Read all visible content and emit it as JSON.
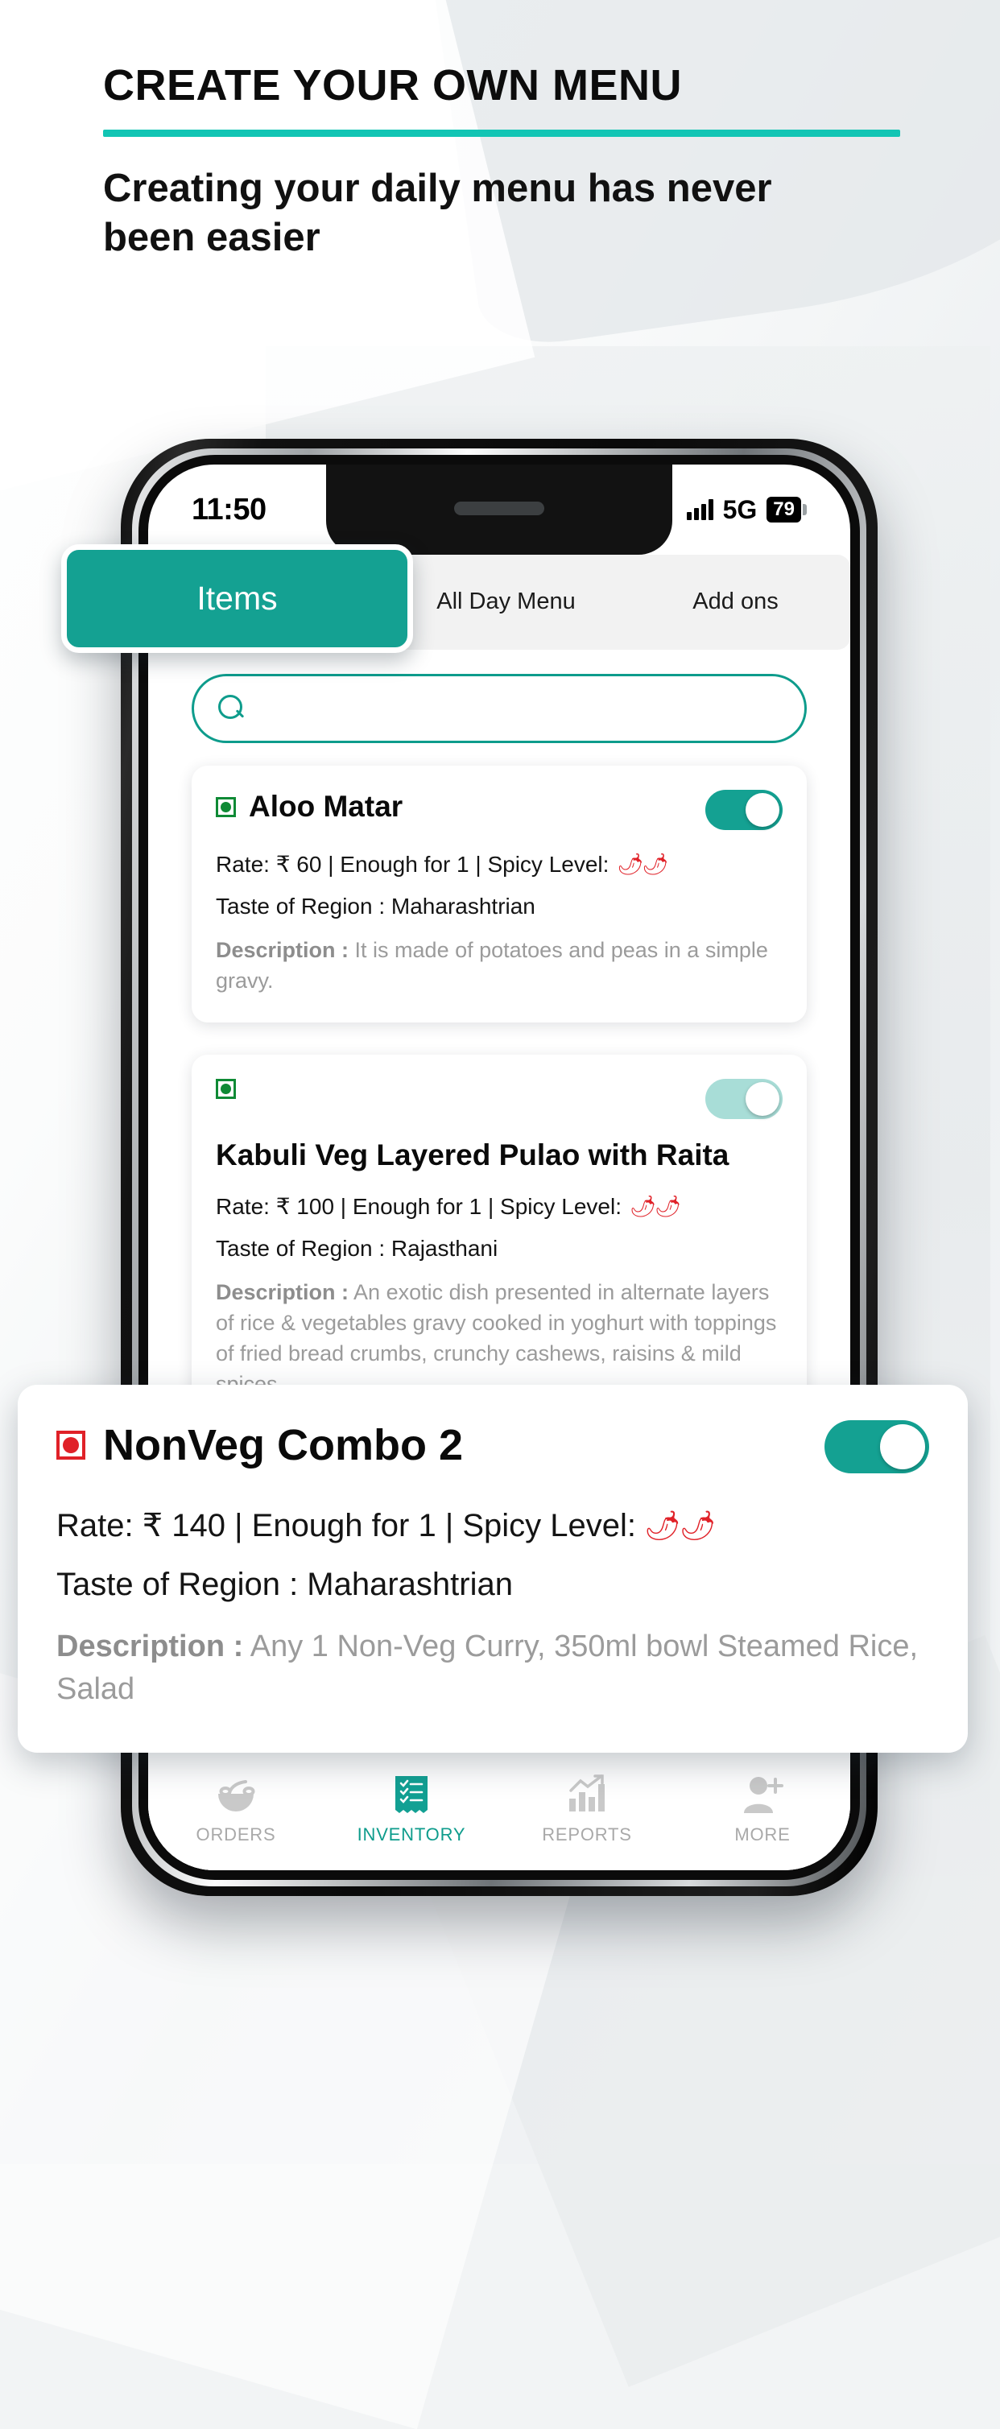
{
  "promo": {
    "headline": "CREATE YOUR OWN MENU",
    "subheadline": "Creating your daily menu has never been easier"
  },
  "colors": {
    "teal": "#14a192",
    "teal_bright": "#12c5b4",
    "veg_green": "#0f8a35",
    "nonveg_red": "#e02128",
    "muted_text": "#9b9b9b"
  },
  "status_bar": {
    "time": "11:50",
    "network": "5G",
    "battery": "79",
    "signal_icon": "signal-bars-icon"
  },
  "tabs": [
    {
      "label": "Items",
      "active": true
    },
    {
      "label": "All Day Menu",
      "active": false
    },
    {
      "label": "Add ons",
      "active": false
    }
  ],
  "search": {
    "value": "",
    "placeholder": "",
    "icon": "search-icon"
  },
  "items": [
    {
      "name": "Aloo Matar",
      "diet": "veg",
      "enabled": true,
      "rate_label": "Rate: ₹ 60 | Enough for 1 | Spicy Level:",
      "spicy_level": 2,
      "region_label": "Taste of Region : Maharashtrian",
      "description_label": "Description :",
      "description": "It is made of potatoes and peas in a simple gravy.",
      "title_below_icon": false
    },
    {
      "name": "Kabuli Veg Layered Pulao with Raita",
      "diet": "veg",
      "enabled": false,
      "rate_label": "Rate: ₹ 100 | Enough for 1 | Spicy Level:",
      "spicy_level": 2,
      "region_label": "Taste of Region : Rajasthani",
      "description_label": "Description :",
      "description": "An exotic dish presented in alternate layers of rice & vegetables gravy cooked in yoghurt with toppings of fried bread crumbs, crunchy cashews, raisins & mild spices",
      "title_below_icon": true
    }
  ],
  "featured_item": {
    "name": "NonVeg Combo 2",
    "diet": "nonveg",
    "enabled": true,
    "rate_label": "Rate: ₹ 140 | Enough for 1 | Spicy Level:",
    "spicy_level": 2,
    "region_label": "Taste of Region : Maharashtrian",
    "description_label": "Description :",
    "description": "Any 1 Non-Veg Curry, 350ml bowl Steamed Rice, Salad"
  },
  "bottom_nav": [
    {
      "label": "ORDERS",
      "icon": "bowl-icon",
      "active": false
    },
    {
      "label": "INVENTORY",
      "icon": "receipt-checklist-icon",
      "active": true
    },
    {
      "label": "REPORTS",
      "icon": "bar-chart-arrow-icon",
      "active": false
    },
    {
      "label": "MORE",
      "icon": "person-add-icon",
      "active": false
    }
  ],
  "chili_glyph": "🌶"
}
